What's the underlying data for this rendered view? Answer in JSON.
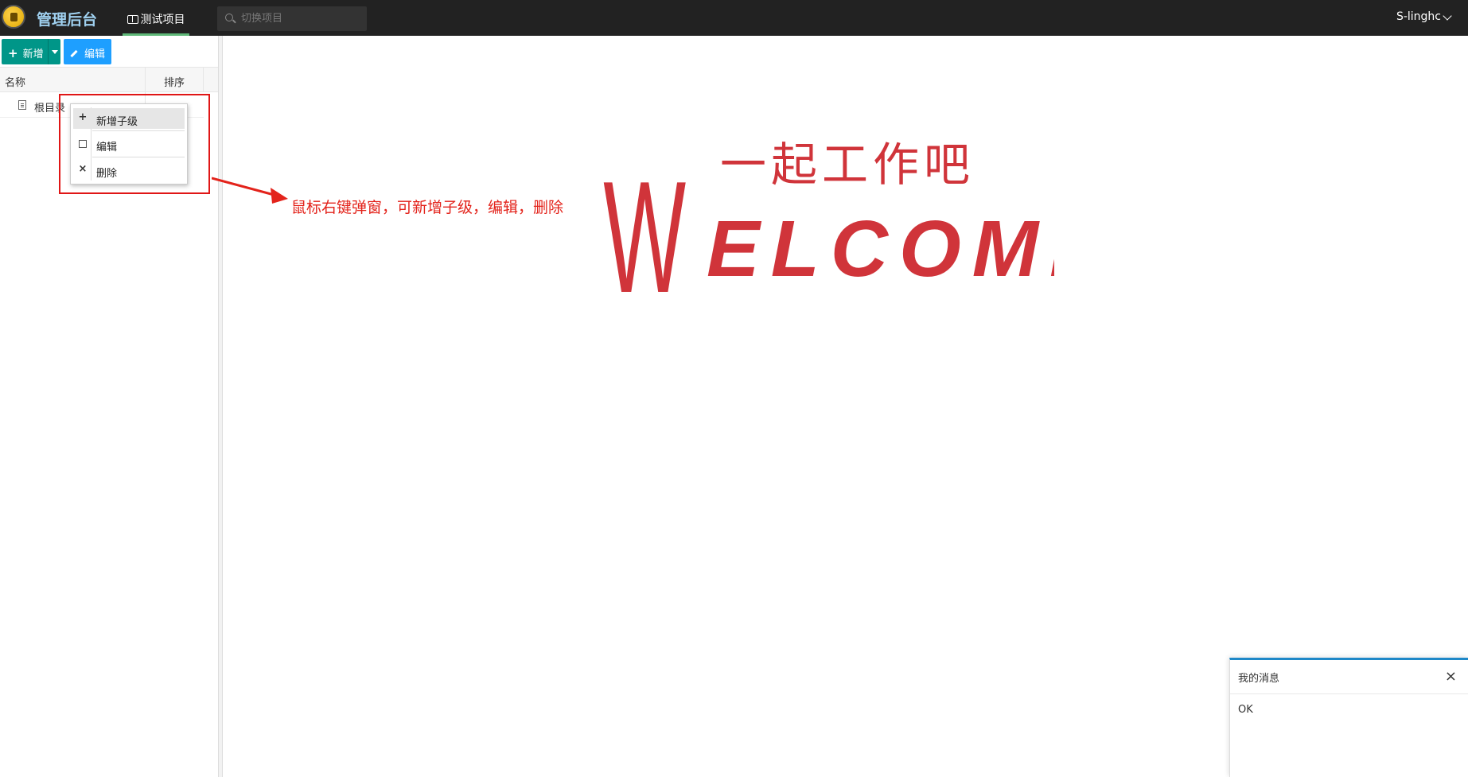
{
  "app": {
    "brand": "管理后台",
    "project_tab": "测试项目",
    "search_placeholder": "切换项目",
    "user": "S-linghc"
  },
  "toolbar": {
    "add_label": "新增",
    "edit_label": "编辑"
  },
  "tree_table": {
    "columns": [
      "名称",
      "排序"
    ],
    "rows": [
      {
        "name": "根目录",
        "sort": ""
      }
    ]
  },
  "context_menu": {
    "items": [
      {
        "label": "新增子级",
        "icon": "plus-icon"
      },
      {
        "label": "编辑",
        "icon": "edit-icon"
      },
      {
        "label": "删除",
        "icon": "close-icon"
      }
    ]
  },
  "annotation": {
    "text": "鼠标右键弹窗，可新增子级，编辑，删除",
    "color": "#e3231b"
  },
  "welcome": {
    "handwritten": "一起工作吧",
    "title_initial": "W",
    "title_rest": "ELCOME",
    "color": "#d0343a"
  },
  "message_panel": {
    "title": "我的消息",
    "close": "×",
    "body": "OK"
  },
  "colors": {
    "navbar": "#222222",
    "add_button": "#009688",
    "edit_button": "#1e9fff",
    "tab_underline": "#5fb878"
  }
}
